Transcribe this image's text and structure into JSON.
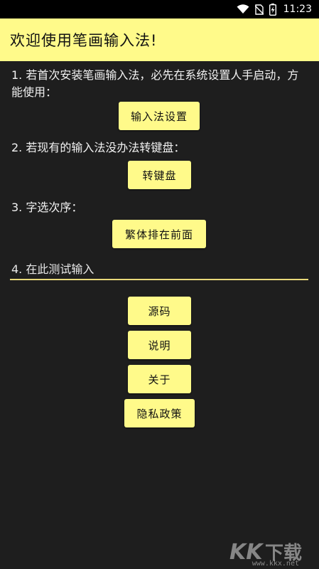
{
  "status_bar": {
    "time": "11:23",
    "icons": [
      "wifi-icon",
      "no-sim-icon",
      "battery-charging-icon"
    ]
  },
  "title_bar": {
    "title": "欢迎使用笔画输入法!",
    "background": "#fffa8a"
  },
  "steps": {
    "step1_text": "1. 若首次安装笔画输入法，必先在系统设置人手启动，方能使用：",
    "step1_button": "输入法设置",
    "step2_text": "2. 若现有的输入法没办法转键盘：",
    "step2_button": "转键盘",
    "step3_text": "3. 字选次序：",
    "step3_button": "繁体排在前面",
    "step4_placeholder": "4. 在此测试输入"
  },
  "links": {
    "source_button": "源码",
    "help_button": "说明",
    "about_button": "关于",
    "privacy_button": "隐私政策"
  },
  "watermark": {
    "logo_text": "KK下载",
    "url": "www.kkx.net"
  },
  "colors": {
    "accent_yellow": "#fffa8a",
    "background": "#1e1e1e",
    "underline": "#e8d97a"
  }
}
